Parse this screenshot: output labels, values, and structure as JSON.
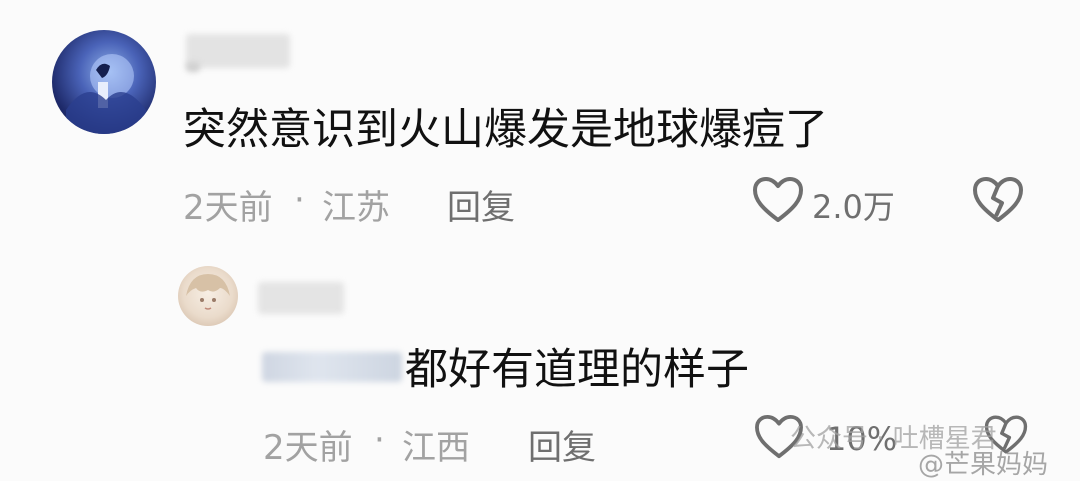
{
  "comments": [
    {
      "text": "突然意识到火山爆发是地球爆痘了",
      "time": "2天前",
      "location": "江苏",
      "reply_label": "回复",
      "likes": "2.0万"
    },
    {
      "text": "都好有道理的样子",
      "time": "2天前",
      "location": "江西",
      "reply_label": "回复",
      "likes": "10%"
    }
  ],
  "separator": "·",
  "watermarks": {
    "channel": "公众号 · 吐槽星君",
    "weibo": "@芒果妈妈"
  },
  "colors": {
    "meta": "#a2a2a2",
    "action": "#6f6f6f",
    "background": "#fbfbfb"
  }
}
